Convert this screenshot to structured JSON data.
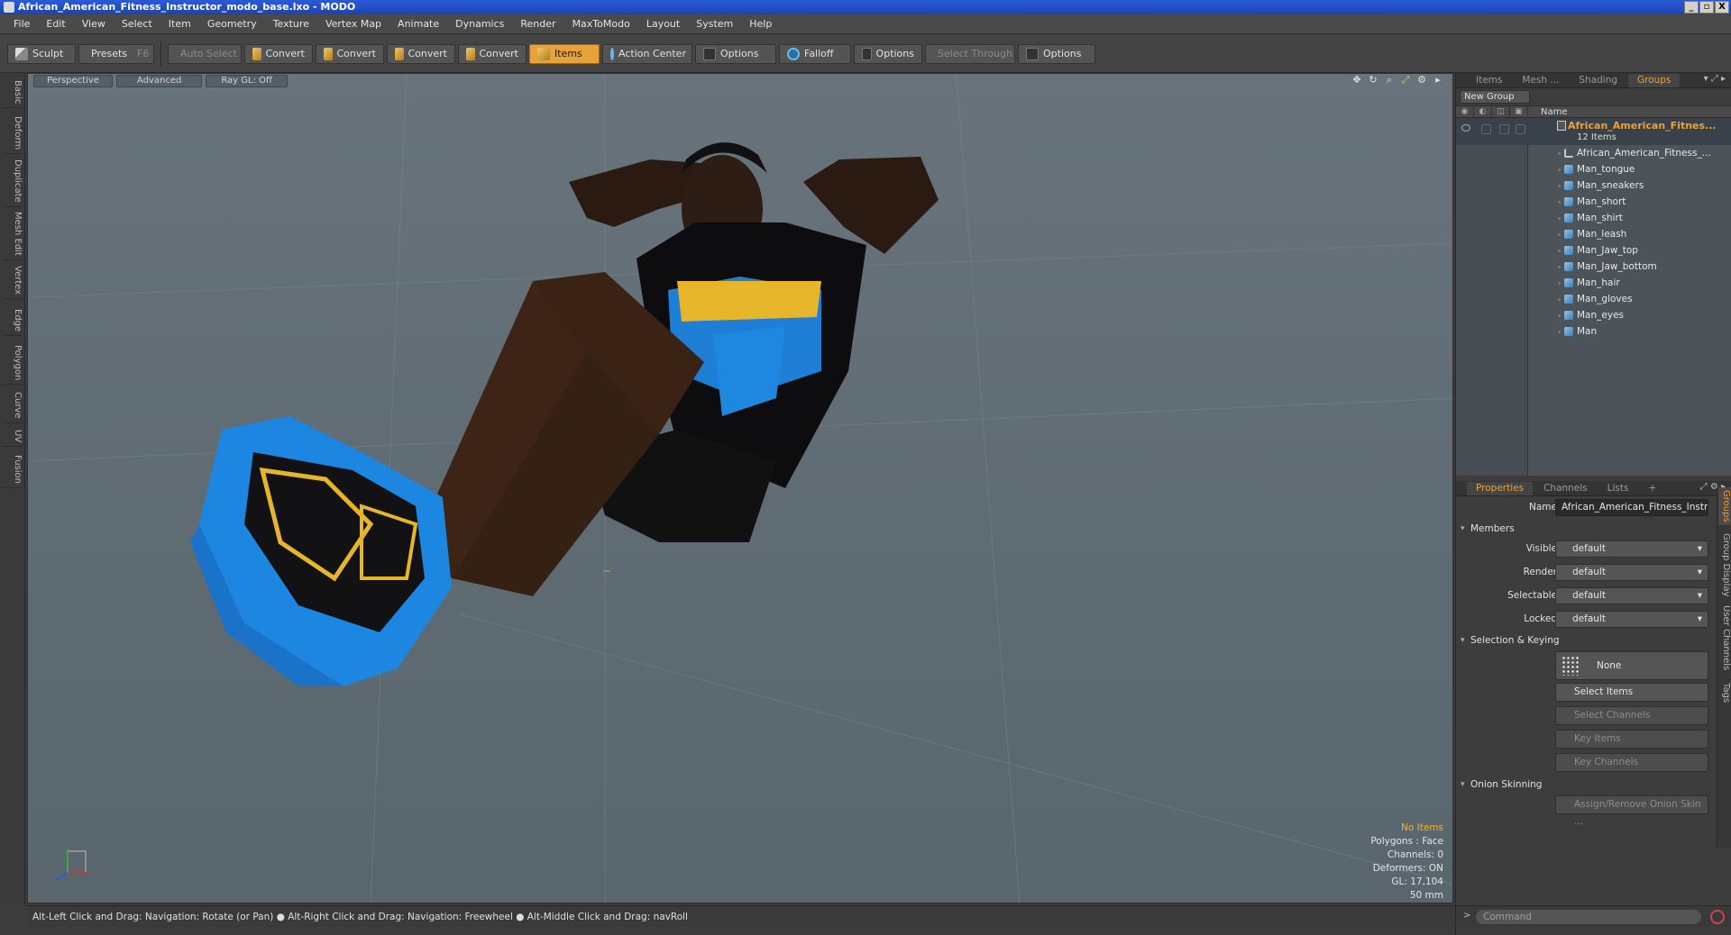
{
  "window": {
    "title": "African_American_Fitness_Instructor_modo_base.lxo - MODO",
    "min": "_",
    "max": "▫",
    "close": "X"
  },
  "menu": [
    "File",
    "Edit",
    "View",
    "Select",
    "Item",
    "Geometry",
    "Texture",
    "Vertex Map",
    "Animate",
    "Dynamics",
    "Render",
    "MaxToModo",
    "Layout",
    "System",
    "Help"
  ],
  "toolbar": {
    "sculpt": "Sculpt",
    "presets": "Presets",
    "presets_key": "F6",
    "auto_select": "Auto Select",
    "convert1": "Convert",
    "convert2": "Convert",
    "convert3": "Convert",
    "convert4": "Convert",
    "items": "Items",
    "action_center": "Action Center",
    "options1": "Options",
    "falloff": "Falloff",
    "options2": "Options",
    "select_through": "Select Through",
    "options3": "Options"
  },
  "left_tabs": [
    "Basic",
    "Deform",
    "Duplicate",
    "Mesh Edit",
    "Vertex",
    "Edge",
    "Polygon",
    "Curve",
    "UV",
    "Fusion"
  ],
  "viewport": {
    "view": "Perspective",
    "shading": "Advanced",
    "raygl": "Ray GL: Off",
    "stats": {
      "selection": "No Items",
      "polygons": "Polygons : Face",
      "channels": "Channels: 0",
      "deformers": "Deformers: ON",
      "gl": "GL: 17,104",
      "scale": "50 mm"
    }
  },
  "status": "Alt-Left Click and Drag: Navigation: Rotate (or Pan) ● Alt-Right Click and Drag: Navigation: Freewheel ● Alt-Middle Click and Drag: navRoll",
  "top_panel": {
    "tabs": [
      "Items",
      "Mesh ...",
      "Shading",
      "Groups"
    ],
    "new_group": "New Group",
    "col_name": "Name",
    "group_name": "African_American_Fitnes...",
    "group_count": "12 Items",
    "items": [
      "African_American_Fitness_...",
      "Man_tongue",
      "Man_sneakers",
      "Man_short",
      "Man_shirt",
      "Man_leash",
      "Man_Jaw_top",
      "Man_Jaw_bottom",
      "Man_hair",
      "Man_gloves",
      "Man_eyes",
      "Man"
    ]
  },
  "bottom_panel": {
    "tabs": [
      "Properties",
      "Channels",
      "Lists"
    ],
    "add_tab": "+",
    "name_label": "Name",
    "name_value": "African_American_Fitness_Instru",
    "members": "Members",
    "visible_label": "Visible",
    "visible_value": "default",
    "render_label": "Render",
    "render_value": "default",
    "selectable_label": "Selectable",
    "selectable_value": "default",
    "locked_label": "Locked",
    "locked_value": "default",
    "selection_keying": "Selection & Keying",
    "none_btn": "None",
    "select_items": "Select Items",
    "select_channels": "Select Channels",
    "key_items": "Key Items",
    "key_channels": "Key Channels",
    "onion": "Onion Skinning",
    "assign_onion": "Assign/Remove Onion Skin ...",
    "side_tabs": [
      "Groups",
      "Group Display",
      "User Channels",
      "Tags"
    ]
  },
  "command": {
    "prompt": ">",
    "placeholder": "Command"
  },
  "colors": {
    "accent": "#f0a030",
    "active_tool": "#e8a23a"
  }
}
